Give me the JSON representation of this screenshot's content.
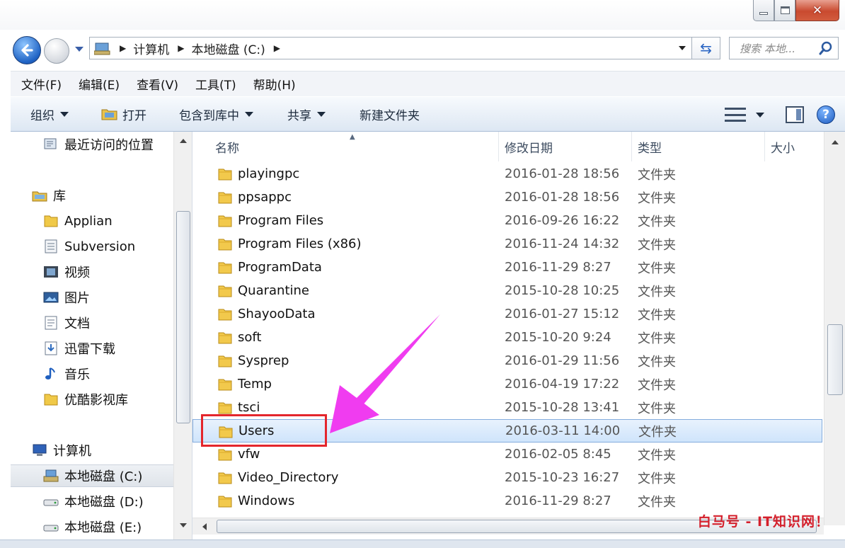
{
  "window": {
    "close_glyph": "✕"
  },
  "address": {
    "breadcrumbs": [
      "计算机",
      "本地磁盘 (C:)"
    ],
    "search_placeholder": "搜索 本地..."
  },
  "menubar": [
    "文件(F)",
    "编辑(E)",
    "查看(V)",
    "工具(T)",
    "帮助(H)"
  ],
  "commandbar": {
    "organize": "组织",
    "open": "打开",
    "include_library": "包含到库中",
    "share": "共享",
    "new_folder": "新建文件夹",
    "help_glyph": "?"
  },
  "navpane": {
    "recent": "最近访问的位置",
    "libraries": "库",
    "library_items": [
      "Applian",
      "Subversion",
      "视频",
      "图片",
      "文档",
      "迅雷下载",
      "音乐",
      "优酷影视库"
    ],
    "computer": "计算机",
    "drives": [
      "本地磁盘 (C:)",
      "本地磁盘 (D:)",
      "本地磁盘 (E:)"
    ],
    "selected_drive": "本地磁盘 (C:)"
  },
  "columns": {
    "name": "名称",
    "date": "修改日期",
    "type": "类型",
    "size": "大小"
  },
  "files": [
    {
      "name": "playingpc",
      "date": "2016-01-28 18:56",
      "type": "文件夹"
    },
    {
      "name": "ppsappc",
      "date": "2016-01-28 18:56",
      "type": "文件夹"
    },
    {
      "name": "Program Files",
      "date": "2016-09-26 16:22",
      "type": "文件夹"
    },
    {
      "name": "Program Files (x86)",
      "date": "2016-11-24 14:32",
      "type": "文件夹"
    },
    {
      "name": "ProgramData",
      "date": "2016-11-29 8:27",
      "type": "文件夹"
    },
    {
      "name": "Quarantine",
      "date": "2015-10-28 10:25",
      "type": "文件夹"
    },
    {
      "name": "ShayooData",
      "date": "2016-01-27 15:12",
      "type": "文件夹"
    },
    {
      "name": "soft",
      "date": "2015-10-20 9:24",
      "type": "文件夹"
    },
    {
      "name": "Sysprep",
      "date": "2016-01-29 11:56",
      "type": "文件夹"
    },
    {
      "name": "Temp",
      "date": "2016-04-19 17:22",
      "type": "文件夹"
    },
    {
      "name": "tsci",
      "date": "2015-10-28 13:41",
      "type": "文件夹"
    },
    {
      "name": "Users",
      "date": "2016-03-11 14:00",
      "type": "文件夹"
    },
    {
      "name": "vfw",
      "date": "2016-02-05 8:45",
      "type": "文件夹"
    },
    {
      "name": "Video_Directory",
      "date": "2015-10-23 16:27",
      "type": "文件夹"
    },
    {
      "name": "Windows",
      "date": "2016-11-29 8:27",
      "type": "文件夹"
    }
  ],
  "selected_file": "Users",
  "watermark": {
    "part1": "白马号 - ",
    "part2": "IT知识网！"
  },
  "colors": {
    "highlight": "#e4262c",
    "arrow": "#f03cf0",
    "selection": "#cfe4fb",
    "watermark": "#d4202c"
  }
}
